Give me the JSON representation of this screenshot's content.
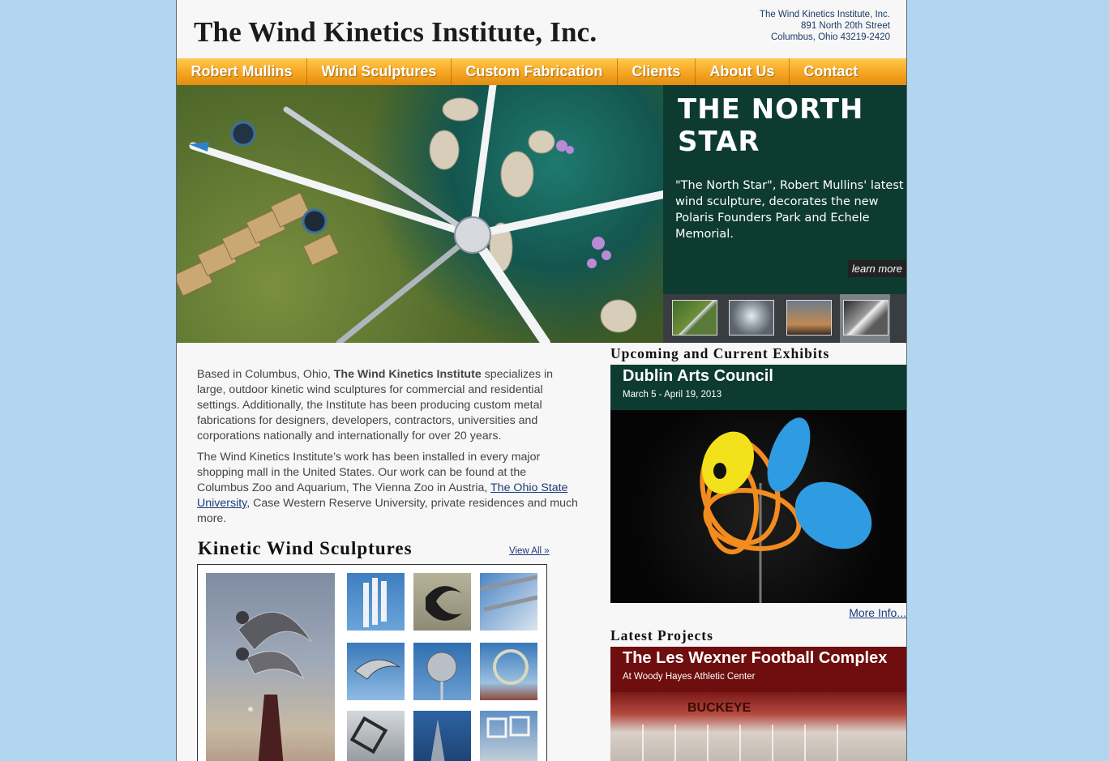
{
  "header": {
    "title": "The Wind Kinetics Institute, Inc.",
    "address": [
      "The Wind Kinetics Institute, Inc.",
      "891 North 20th Street",
      "Columbus, Ohio 43219-2420"
    ]
  },
  "nav": {
    "items": [
      "Robert Mullins",
      "Wind Sculptures",
      "Custom Fabrication",
      "Clients",
      "About Us",
      "Contact"
    ]
  },
  "hero": {
    "title": "THE NORTH STAR",
    "text": "\"The North Star\", Robert Mullins' latest wind sculpture, decorates the new Polaris Founders Park and Echele Memorial.",
    "link": "learn more",
    "active_thumb": 4
  },
  "intro": {
    "p1_before": "Based in Columbus, Ohio, ",
    "p1_bold": "The Wind Kinetics Institute",
    "p1_after": " specializes in large, outdoor kinetic wind sculptures for commercial and residential settings. Additionally, the Institute has been producing custom metal fabrications for designers, developers, contractors, universities and corporations nationally and internationally for over 20 years.",
    "p2_before": "The Wind Kinetics Institute’s work has been installed in every major shopping mall in the United States. Our work can be found at the Columbus Zoo and Aquarium, The Vienna Zoo in Austria, ",
    "p2_link": "The Ohio State University",
    "p2_after": ", Case Western Reserve University, private residences and much more."
  },
  "sculptures": {
    "title": "Kinetic Wind Sculptures",
    "view_all": "View All »"
  },
  "exhibits": {
    "heading": "Upcoming and Current Exhibits",
    "title": "Dublin Arts Council",
    "dates": "March 5 - April 19, 2013",
    "more": "More Info..."
  },
  "projects": {
    "heading": "Latest Projects",
    "title": "The Les Wexner Football Complex",
    "subtitle": "At Woody Hayes Athletic Center",
    "sign_text": "BUCKEYE"
  },
  "colors": {
    "nav_orange": "#f6a522",
    "hero_green": "#0d3b30",
    "project_red": "#6e0e0e",
    "link_blue": "#1b3a7a"
  }
}
